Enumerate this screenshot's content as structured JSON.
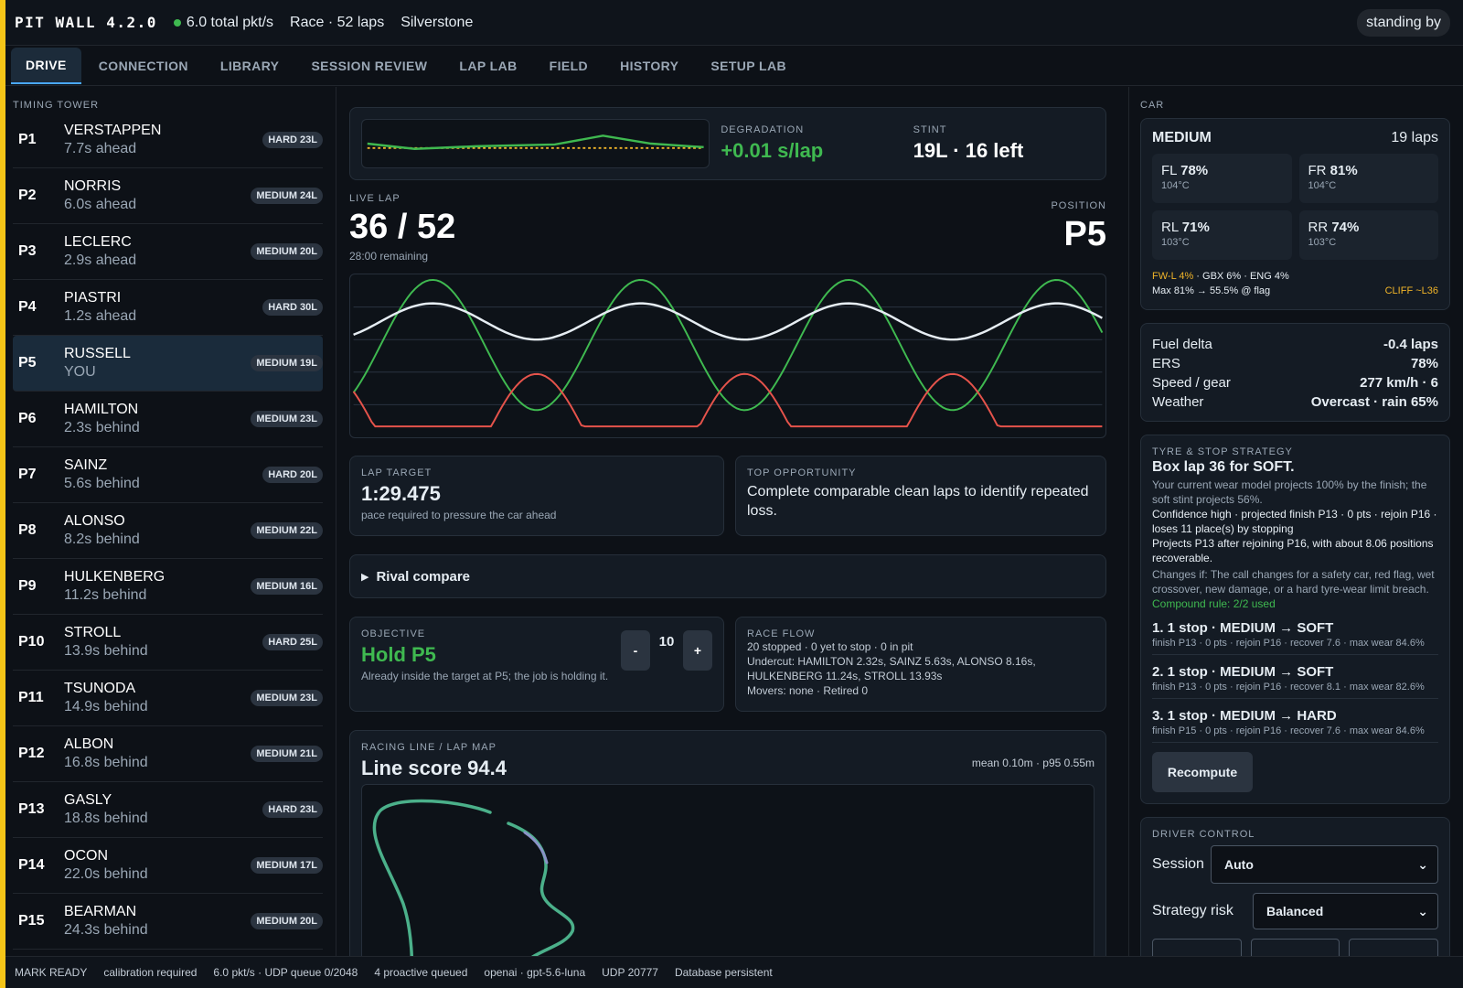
{
  "topbar": {
    "title": "PIT WALL 4.2.0",
    "packets": "6.0 total pkt/s",
    "race": "Race · 52 laps",
    "track": "Silverstone",
    "state": "standing by"
  },
  "tabs": [
    "DRIVE",
    "CONNECTION",
    "LIBRARY",
    "SESSION REVIEW",
    "LAP LAB",
    "FIELD",
    "HISTORY",
    "SETUP LAB"
  ],
  "tower": {
    "label": "TIMING TOWER",
    "rows": [
      {
        "pos": "P1",
        "name": "VERSTAPPEN",
        "gap": "7.7s ahead",
        "tyre": "HARD 23L"
      },
      {
        "pos": "P2",
        "name": "NORRIS",
        "gap": "6.0s ahead",
        "tyre": "MEDIUM 24L"
      },
      {
        "pos": "P3",
        "name": "LECLERC",
        "gap": "2.9s ahead",
        "tyre": "MEDIUM 20L"
      },
      {
        "pos": "P4",
        "name": "PIASTRI",
        "gap": "1.2s ahead",
        "tyre": "HARD 30L"
      },
      {
        "pos": "P5",
        "name": "RUSSELL",
        "gap": "YOU",
        "tyre": "MEDIUM 19L"
      },
      {
        "pos": "P6",
        "name": "HAMILTON",
        "gap": "2.3s behind",
        "tyre": "MEDIUM 23L"
      },
      {
        "pos": "P7",
        "name": "SAINZ",
        "gap": "5.6s behind",
        "tyre": "HARD 20L"
      },
      {
        "pos": "P8",
        "name": "ALONSO",
        "gap": "8.2s behind",
        "tyre": "MEDIUM 22L"
      },
      {
        "pos": "P9",
        "name": "HULKENBERG",
        "gap": "11.2s behind",
        "tyre": "MEDIUM 16L"
      },
      {
        "pos": "P10",
        "name": "STROLL",
        "gap": "13.9s behind",
        "tyre": "HARD 25L"
      },
      {
        "pos": "P11",
        "name": "TSUNODA",
        "gap": "14.9s behind",
        "tyre": "MEDIUM 23L"
      },
      {
        "pos": "P12",
        "name": "ALBON",
        "gap": "16.8s behind",
        "tyre": "MEDIUM 21L"
      },
      {
        "pos": "P13",
        "name": "GASLY",
        "gap": "18.8s behind",
        "tyre": "HARD 23L"
      },
      {
        "pos": "P14",
        "name": "OCON",
        "gap": "22.0s behind",
        "tyre": "MEDIUM 17L"
      },
      {
        "pos": "P15",
        "name": "BEARMAN",
        "gap": "24.3s behind",
        "tyre": "MEDIUM 20L"
      }
    ]
  },
  "center": {
    "degradation_label": "DEGRADATION",
    "degradation_value": "+0.01 s/lap",
    "stint_label": "STINT",
    "stint_value": "19L · 16 left",
    "live_lap_label": "LIVE LAP",
    "live_lap_value": "36 / 52",
    "remaining": "28:00 remaining",
    "position_label": "POSITION",
    "position_value": "P5",
    "lap_target_label": "LAP TARGET",
    "lap_target_value": "1:29.475",
    "lap_target_note": "pace required to pressure the car ahead",
    "top_opp_label": "TOP OPPORTUNITY",
    "top_opp_text": "Complete comparable clean laps to identify repeated loss.",
    "rival_compare": "Rival compare",
    "objective_label": "OBJECTIVE",
    "objective_value": "Hold P5",
    "objective_note": "Already inside the target at P5; the job is holding it.",
    "stepper_minus": "-",
    "stepper_value": "10",
    "stepper_plus": "+",
    "race_flow_label": "RACE FLOW",
    "race_flow_lines": [
      "20 stopped · 0 yet to stop · 0 in pit",
      "Undercut: HAMILTON 2.32s, SAINZ 5.63s, ALONSO 8.16s, HULKENBERG 11.24s, STROLL 13.93s",
      "Movers: none · Retired 0"
    ],
    "racing_line_label": "RACING LINE / LAP MAP",
    "line_score": "Line score 94.4",
    "line_meta": "mean 0.10m · p95 0.55m"
  },
  "car": {
    "label": "CAR",
    "compound": "MEDIUM",
    "laps": "19 laps",
    "tyres": [
      {
        "corner": "FL",
        "wear": "78%",
        "temp": "104°C"
      },
      {
        "corner": "FR",
        "wear": "81%",
        "temp": "104°C"
      },
      {
        "corner": "RL",
        "wear": "71%",
        "temp": "103°C"
      },
      {
        "corner": "RR",
        "wear": "74%",
        "temp": "103°C"
      }
    ],
    "damage_warn": "FW-L 4%",
    "damage_rest": " · GBX 6% · ENG 4%",
    "max_line": "Max 81% → 55.5% @ flag",
    "cliff": "CLIFF ~L36"
  },
  "info": [
    {
      "k": "Fuel delta",
      "v": "-0.4 laps"
    },
    {
      "k": "ERS",
      "v": "78%"
    },
    {
      "k": "Speed / gear",
      "v": "277 km/h · 6"
    },
    {
      "k": "Weather",
      "v": "Overcast · rain 65%"
    }
  ],
  "strategy": {
    "label": "TYRE & STOP STRATEGY",
    "headline": "Box lap 36 for SOFT.",
    "text1": "Your current wear model projects 100% by the finish; the soft stint projects 56%.",
    "text2": "Confidence high · projected finish P13 · 0 pts · rejoin P16 · loses 11 place(s) by stopping",
    "text3": "Projects P13 after rejoining P16, with about 8.06 positions recoverable.",
    "text4": "Changes if: The call changes for a safety car, red flag, wet crossover, new damage, or a hard tyre-wear limit breach.",
    "rule": "Compound rule: 2/2 used",
    "options": [
      {
        "title": "1. 1 stop · MEDIUM → SOFT",
        "sub": "finish P13 · 0 pts · rejoin P16 · recover 7.6 · max wear 84.6%"
      },
      {
        "title": "2. 1 stop · MEDIUM → SOFT",
        "sub": "finish P13 · 0 pts · rejoin P16 · recover 8.1 · max wear 82.6%"
      },
      {
        "title": "3. 1 stop · MEDIUM → HARD",
        "sub": "finish P15 · 0 pts · rejoin P16 · recover 7.6 · max wear 84.6%"
      }
    ],
    "recompute": "Recompute"
  },
  "driver_control": {
    "label": "DRIVER CONTROL",
    "session_label": "Session",
    "session_value": "Auto",
    "risk_label": "Strategy risk",
    "risk_value": "Balanced"
  },
  "status": [
    "MARK READY",
    "calibration required",
    "6.0 pkt/s · UDP queue 0/2048",
    "4 proactive queued",
    "openai · gpt-5.6-luna",
    "UDP 20777",
    "Database persistent"
  ],
  "colors": {
    "accent": "#f5c518",
    "green": "#3fb950",
    "red": "#e5534b",
    "amber": "#f0b429"
  },
  "icons": {
    "rival_toggle": "triangle-right-icon",
    "select_arrow": "chevron-down-icon",
    "live_dot": "status-dot-icon"
  }
}
